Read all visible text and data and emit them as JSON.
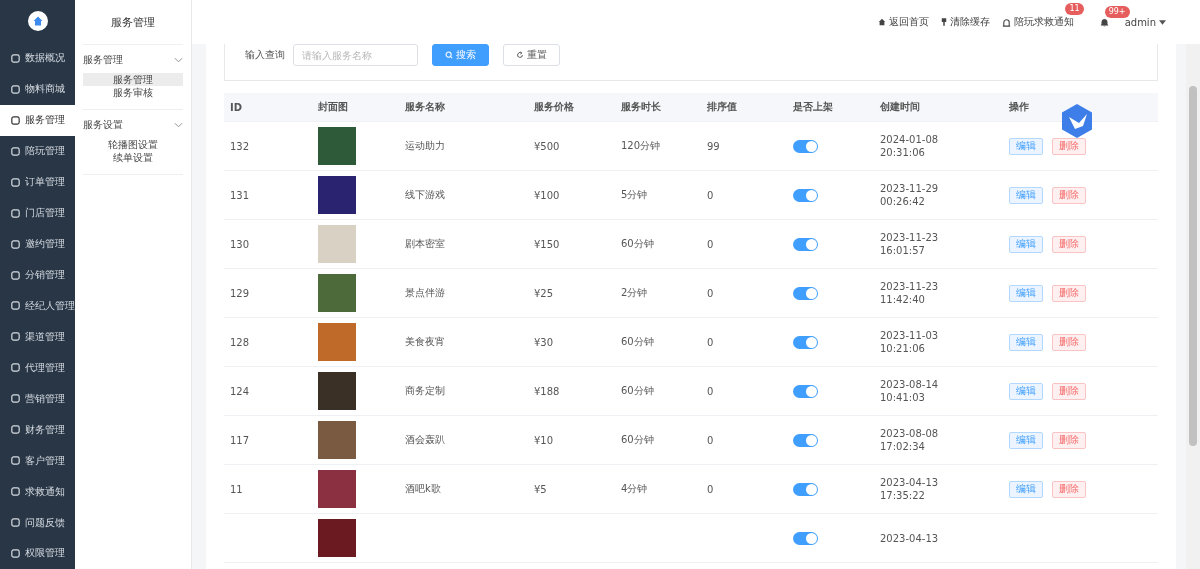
{
  "sidebar": {
    "items": [
      {
        "label": "数据概况",
        "selected": false
      },
      {
        "label": "物料商城",
        "selected": false
      },
      {
        "label": "服务管理",
        "selected": true
      },
      {
        "label": "陪玩管理",
        "selected": false
      },
      {
        "label": "订单管理",
        "selected": false
      },
      {
        "label": "门店管理",
        "selected": false
      },
      {
        "label": "邀约管理",
        "selected": false
      },
      {
        "label": "分销管理",
        "selected": false
      },
      {
        "label": "经纪人管理",
        "selected": false
      },
      {
        "label": "渠道管理",
        "selected": false
      },
      {
        "label": "代理管理",
        "selected": false
      },
      {
        "label": "营销管理",
        "selected": false
      },
      {
        "label": "财务管理",
        "selected": false
      },
      {
        "label": "客户管理",
        "selected": false
      },
      {
        "label": "求救通知",
        "selected": false
      },
      {
        "label": "问题反馈",
        "selected": false
      },
      {
        "label": "权限管理",
        "selected": false
      }
    ]
  },
  "submenu": {
    "title": "服务管理",
    "groups": [
      {
        "title": "服务管理",
        "expanded": true,
        "items": [
          {
            "label": "服务管理",
            "selected": true
          },
          {
            "label": "服务审核",
            "selected": false
          }
        ]
      },
      {
        "title": "服务设置",
        "expanded": true,
        "items": [
          {
            "label": "轮播图设置",
            "selected": false
          },
          {
            "label": "续单设置",
            "selected": false
          }
        ]
      }
    ]
  },
  "header": {
    "home": "返回首页",
    "clear_cache": "清除缓存",
    "sos": {
      "label": "陪玩求救通知",
      "badge": "11"
    },
    "bell_badge": "99+",
    "user": "admin"
  },
  "search": {
    "label": "输入查询",
    "placeholder": "请输入服务名称",
    "search_button": "搜索",
    "reset_button": "重置"
  },
  "table": {
    "columns": [
      "ID",
      "封面图",
      "服务名称",
      "服务价格",
      "服务时长",
      "排序值",
      "是否上架",
      "创建时间",
      "操作"
    ],
    "rows": [
      {
        "id": "132",
        "name": "运动助力",
        "price": "¥500",
        "duration": "120分钟",
        "sort": "99",
        "on": true,
        "date": "2024-01-08",
        "time": "20:31:06",
        "edit": "编辑",
        "delete": "删除"
      },
      {
        "id": "131",
        "name": "线下游戏",
        "price": "¥100",
        "duration": "5分钟",
        "sort": "0",
        "on": true,
        "date": "2023-11-29",
        "time": "00:26:42",
        "edit": "编辑",
        "delete": "删除"
      },
      {
        "id": "130",
        "name": "剧本密室",
        "price": "¥150",
        "duration": "60分钟",
        "sort": "0",
        "on": true,
        "date": "2023-11-23",
        "time": "16:01:57",
        "edit": "编辑",
        "delete": "删除"
      },
      {
        "id": "129",
        "name": "景点伴游",
        "price": "¥25",
        "duration": "2分钟",
        "sort": "0",
        "on": true,
        "date": "2023-11-23",
        "time": "11:42:40",
        "edit": "编辑",
        "delete": "删除"
      },
      {
        "id": "128",
        "name": "美食夜宵",
        "price": "¥30",
        "duration": "60分钟",
        "sort": "0",
        "on": true,
        "date": "2023-11-03",
        "time": "10:21:06",
        "edit": "编辑",
        "delete": "删除"
      },
      {
        "id": "124",
        "name": "商务定制",
        "price": "¥188",
        "duration": "60分钟",
        "sort": "0",
        "on": true,
        "date": "2023-08-14",
        "time": "10:41:03",
        "edit": "编辑",
        "delete": "删除"
      },
      {
        "id": "117",
        "name": "酒会轰趴",
        "price": "¥10",
        "duration": "60分钟",
        "sort": "0",
        "on": true,
        "date": "2023-08-08",
        "time": "17:02:34",
        "edit": "编辑",
        "delete": "删除"
      },
      {
        "id": "11",
        "name": "酒吧k歌",
        "price": "¥5",
        "duration": "4分钟",
        "sort": "0",
        "on": true,
        "date": "2023-04-13",
        "time": "17:35:22",
        "edit": "编辑",
        "delete": "删除"
      },
      {
        "on": true,
        "date": "2023-04-13"
      }
    ]
  }
}
